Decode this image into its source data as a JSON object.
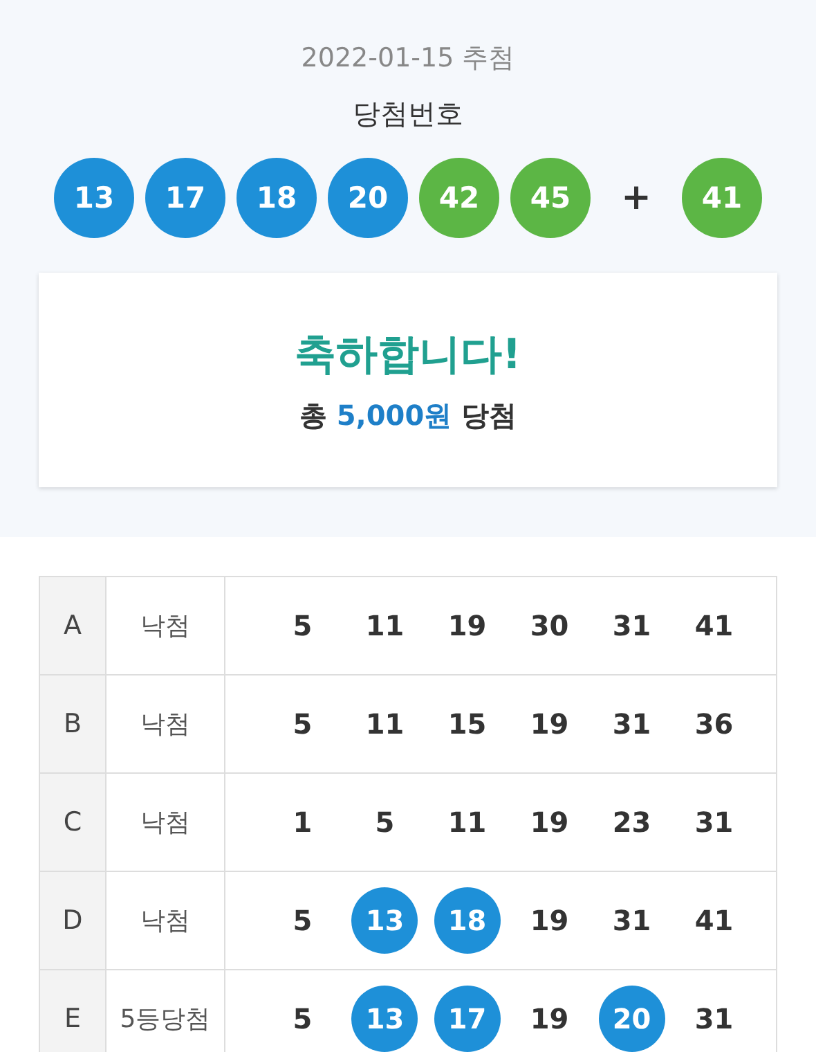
{
  "draw": {
    "date": "2022-01-15 추첨",
    "label": "당첨번호",
    "balls": [
      {
        "number": "13",
        "color": "#1e90d8"
      },
      {
        "number": "17",
        "color": "#1e90d8"
      },
      {
        "number": "18",
        "color": "#1e90d8"
      },
      {
        "number": "20",
        "color": "#1e90d8"
      },
      {
        "number": "42",
        "color": "#5cb645"
      },
      {
        "number": "45",
        "color": "#5cb645"
      }
    ],
    "plus": "+",
    "bonus": {
      "number": "41",
      "color": "#5cb645"
    }
  },
  "result": {
    "title": "축하합니다!",
    "summary": "총 **5,000원** 당첨"
  },
  "table": {
    "rows": [
      {
        "game": "A",
        "status": "낙첨",
        "numbers": [
          {
            "value": "5",
            "matched": false
          },
          {
            "value": "11",
            "matched": false
          },
          {
            "value": "19",
            "matched": false
          },
          {
            "value": "30",
            "matched": false
          },
          {
            "value": "31",
            "matched": false
          },
          {
            "value": "41",
            "matched": false
          }
        ]
      },
      {
        "game": "B",
        "status": "낙첨",
        "numbers": [
          {
            "value": "5",
            "matched": false
          },
          {
            "value": "11",
            "matched": false
          },
          {
            "value": "15",
            "matched": false
          },
          {
            "value": "19",
            "matched": false
          },
          {
            "value": "31",
            "matched": false
          },
          {
            "value": "36",
            "matched": false
          }
        ]
      },
      {
        "game": "C",
        "status": "낙첨",
        "numbers": [
          {
            "value": "1",
            "matched": false
          },
          {
            "value": "5",
            "matched": false
          },
          {
            "value": "11",
            "matched": false
          },
          {
            "value": "19",
            "matched": false
          },
          {
            "value": "23",
            "matched": false
          },
          {
            "value": "31",
            "matched": false
          }
        ]
      },
      {
        "game": "D",
        "status": "낙첨",
        "numbers": [
          {
            "value": "5",
            "matched": false
          },
          {
            "value": "13",
            "matched": true
          },
          {
            "value": "18",
            "matched": true
          },
          {
            "value": "19",
            "matched": false
          },
          {
            "value": "31",
            "matched": false
          },
          {
            "value": "41",
            "matched": false
          }
        ]
      },
      {
        "game": "E",
        "status": "5등당첨",
        "numbers": [
          {
            "value": "5",
            "matched": false
          },
          {
            "value": "13",
            "matched": true
          },
          {
            "value": "17",
            "matched": true
          },
          {
            "value": "19",
            "matched": false
          },
          {
            "value": "20",
            "matched": true
          },
          {
            "value": "31",
            "matched": false
          }
        ]
      }
    ]
  }
}
